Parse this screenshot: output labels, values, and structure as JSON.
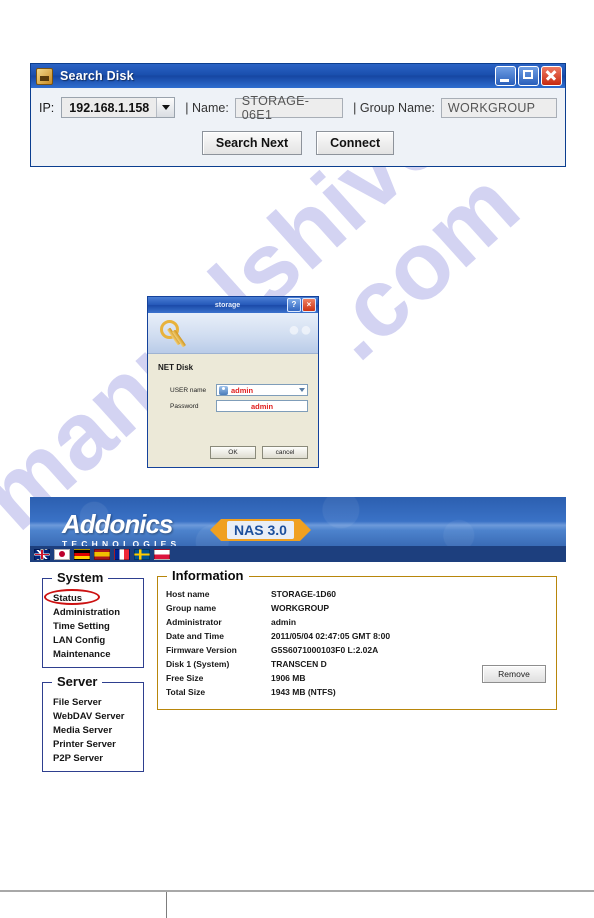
{
  "watermark": {
    "line1": "manualshive",
    "line2": ".com"
  },
  "search_disk_window": {
    "title": "Search Disk",
    "app_icon": "disk-search-icon",
    "window_buttons": {
      "minimize": "minimize-icon",
      "maximize": "maximize-icon",
      "close": "close-icon"
    },
    "ip_label": "IP:",
    "ip_value": "192.168.1.158",
    "name_label": "| Name:",
    "name_value": "STORAGE-06E1",
    "group_label": "| Group Name:",
    "group_value": "WORKGROUP",
    "search_next_button": "Search Next",
    "connect_button": "Connect"
  },
  "login_dialog": {
    "title": "storage",
    "help_button": "?",
    "close_button": "×",
    "heading": "NET Disk",
    "username_label": "USER name",
    "username_value": "admin",
    "password_label": "Password",
    "password_value": "admin",
    "ok_button": "OK",
    "cancel_button": "cancel"
  },
  "nas_ui": {
    "brand": {
      "name": "Addonics",
      "tagline": "TECHNOLOGIES",
      "product_badge": "NAS 3.0",
      "badge_accent": "#f0a020"
    },
    "language_flags": [
      {
        "name": "flag-uk",
        "label": "English"
      },
      {
        "name": "flag-jp",
        "label": "Japanese"
      },
      {
        "name": "flag-de",
        "label": "German"
      },
      {
        "name": "flag-es",
        "label": "Spanish"
      },
      {
        "name": "flag-fr",
        "label": "French"
      },
      {
        "name": "flag-se",
        "label": "Swedish"
      },
      {
        "name": "flag-pl",
        "label": "Polish"
      }
    ],
    "system_menu": {
      "legend": "System",
      "items": [
        {
          "label": "Status",
          "highlighted": true
        },
        {
          "label": "Administration",
          "highlighted": false
        },
        {
          "label": "Time Setting",
          "highlighted": false
        },
        {
          "label": "LAN Config",
          "highlighted": false
        },
        {
          "label": "Maintenance",
          "highlighted": false
        }
      ]
    },
    "server_menu": {
      "legend": "Server",
      "items": [
        {
          "label": "File Server"
        },
        {
          "label": "WebDAV Server"
        },
        {
          "label": "Media Server"
        },
        {
          "label": "Printer Server"
        },
        {
          "label": "P2P Server"
        }
      ]
    },
    "information": {
      "legend": "Information",
      "rows": [
        {
          "key": "Host name",
          "value": "STORAGE-1D60"
        },
        {
          "key": "Group name",
          "value": "WORKGROUP"
        },
        {
          "key": "Administrator",
          "value": "admin"
        },
        {
          "key": "Date and Time",
          "value": "2011/05/04 02:47:05 GMT 8:00"
        },
        {
          "key": "Firmware Version",
          "value": "G5S6071000103F0 L:2.02A"
        },
        {
          "key": "Disk 1 (System)",
          "value": "TRANSCEN D"
        },
        {
          "key": "Free Size",
          "value": "1906 MB"
        },
        {
          "key": "Total Size",
          "value": "1943 MB (NTFS)"
        }
      ],
      "remove_button": "Remove",
      "border_color": "#b8860b"
    }
  }
}
